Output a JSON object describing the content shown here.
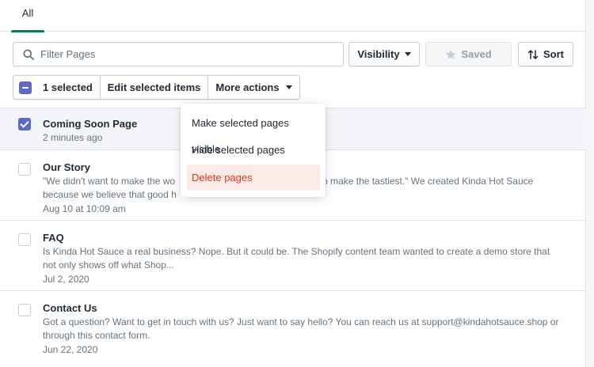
{
  "tabs": [
    {
      "label": "All",
      "selected": true
    }
  ],
  "filter": {
    "placeholder": "Filter Pages",
    "value": ""
  },
  "toolbar": {
    "visibility_label": "Visibility",
    "saved_label": "Saved",
    "sort_label": "Sort"
  },
  "bulk": {
    "selected_label": "1 selected",
    "edit_label": "Edit selected items",
    "more_label": "More actions"
  },
  "menu": {
    "items": [
      {
        "label": "Make selected pages visible"
      },
      {
        "label": "Hide selected pages"
      },
      {
        "label": "Delete pages",
        "destructive": true
      }
    ]
  },
  "pages": [
    {
      "title": "Coming Soon Page",
      "excerpt": "",
      "date": "2 minutes ago",
      "checked": true
    },
    {
      "title": "Our Story",
      "excerpt": "\"We didn't want to make the world's hottest hot sauce. We wanted to make the tastiest.\" We created Kinda Hot Sauce because we believe that good h...",
      "excerpt_visible_a": "\"We didn't want to make the wo",
      "excerpt_visible_b": "ed to make the tastiest.\" We created Kinda Hot Sauce",
      "excerpt_line2": "because we believe that good h",
      "date": "Aug 10 at 10:09 am",
      "checked": false
    },
    {
      "title": "FAQ",
      "excerpt": "Is Kinda Hot Sauce a real business? Nope. But it could be. The Shopify content team wanted to create a demo store that not only shows off what Shop...",
      "date": "Jul 2, 2020",
      "checked": false
    },
    {
      "title": "Contact Us",
      "excerpt": "Got a question? Want to get in touch with us? Just want to say hello? You can reach us at support@kindahotsauce.shop or through this contact form.",
      "date": "Jun 22, 2020",
      "checked": false
    }
  ],
  "colors": {
    "accent": "#5c6ac4",
    "tab_underline": "#008060",
    "destructive": "#de3618"
  },
  "icons": [
    "search-icon",
    "caret-down-icon",
    "star-icon",
    "sort-arrows-icon"
  ]
}
